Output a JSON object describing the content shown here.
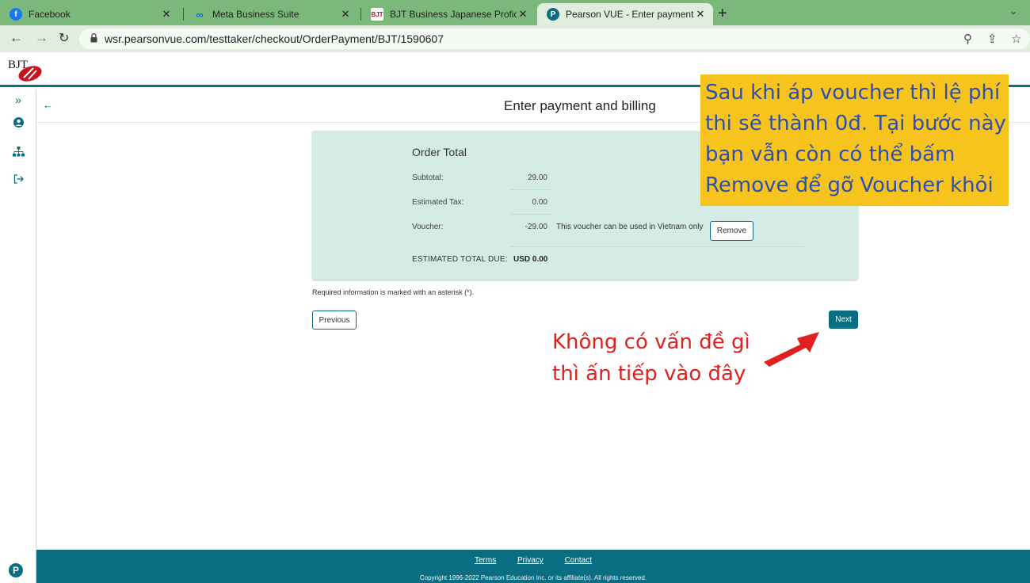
{
  "browser": {
    "tabs": [
      {
        "label": "Facebook",
        "icon": "facebook-icon",
        "icon_color": "#1877f2"
      },
      {
        "label": "Meta Business Suite",
        "icon": "meta-icon",
        "icon_color": "#0668e1"
      },
      {
        "label": "BJT Business Japanese Proficienc",
        "icon": "bjt-icon",
        "icon_color": "#b01e23"
      },
      {
        "label": "Pearson VUE - Enter payment and",
        "icon": "pearson-icon",
        "icon_color": "#0a6e82"
      }
    ],
    "url": "wsr.pearsonvue.com/testtaker/checkout/OrderPayment/BJT/1590607"
  },
  "site": {
    "logo_text": "BJT",
    "page_title": "Enter payment and billing"
  },
  "order": {
    "title": "Order Total",
    "rows": [
      {
        "label": "Subtotal:",
        "value": "29.00"
      },
      {
        "label": "Estimated Tax:",
        "value": "0.00"
      },
      {
        "label": "Voucher:",
        "value": "-29.00"
      }
    ],
    "voucher_note": "This voucher can be used in Vietnam only",
    "remove_label": "Remove",
    "total_label": "ESTIMATED TOTAL DUE:",
    "total_value": "USD 0.00"
  },
  "form": {
    "required_note": "Required information is marked with an asterisk (*).",
    "previous_label": "Previous",
    "next_label": "Next"
  },
  "annotations": {
    "callout": "Sau khi áp voucher thì lệ phí thi sẽ thành 0đ. Tại bước này bạn vẫn còn có thể bấm Remove để gỡ Voucher khỏi",
    "next_hint": "Không có vấn đề gì thì ấn tiếp vào đây"
  },
  "footer": {
    "links": [
      "Terms",
      "Privacy",
      "Contact"
    ],
    "copyright": "Copyright 1996-2022 Pearson Education Inc. or its affiliate(s). All rights reserved."
  }
}
